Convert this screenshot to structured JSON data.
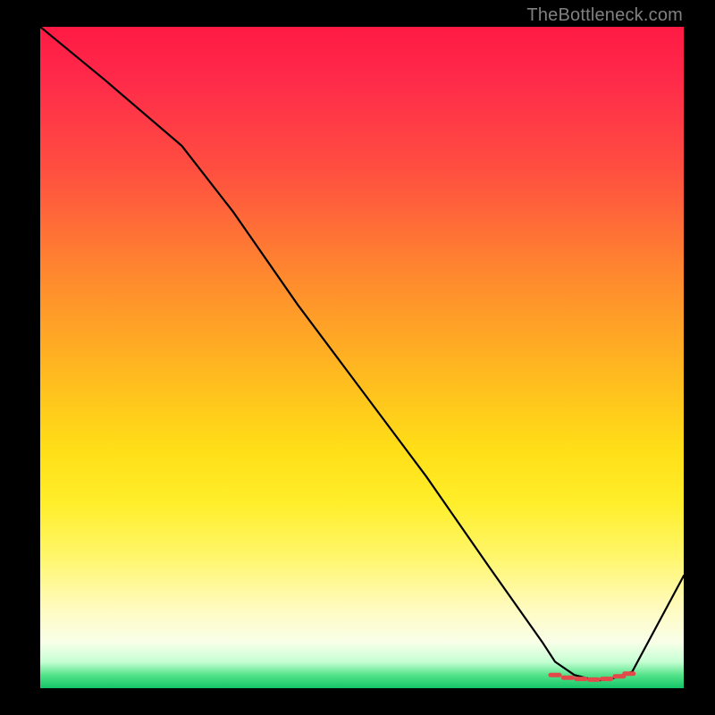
{
  "watermark": "TheBottleneck.com",
  "chart_data": {
    "type": "line",
    "title": "",
    "xlabel": "",
    "ylabel": "",
    "xlim": [
      0,
      100
    ],
    "ylim": [
      0,
      100
    ],
    "series": [
      {
        "name": "curve",
        "x": [
          0,
          10,
          22,
          30,
          40,
          50,
          60,
          70,
          78,
          80,
          83,
          85,
          87,
          89,
          92,
          100
        ],
        "y": [
          100,
          92,
          82,
          72,
          58,
          45,
          32,
          18,
          7,
          4,
          2,
          1.5,
          1.2,
          1.5,
          2.5,
          17
        ]
      }
    ],
    "flat_region_markers": {
      "comment": "short dashed red markers near the minimum",
      "x": [
        80,
        82,
        84,
        86,
        88,
        90,
        91.5
      ],
      "y": [
        2,
        1.6,
        1.4,
        1.3,
        1.4,
        1.8,
        2.2
      ]
    },
    "colors": {
      "line": "#000000",
      "marker": "#e24a4a",
      "gradient_top": "#ff1a44",
      "gradient_bottom": "#15c468"
    }
  }
}
